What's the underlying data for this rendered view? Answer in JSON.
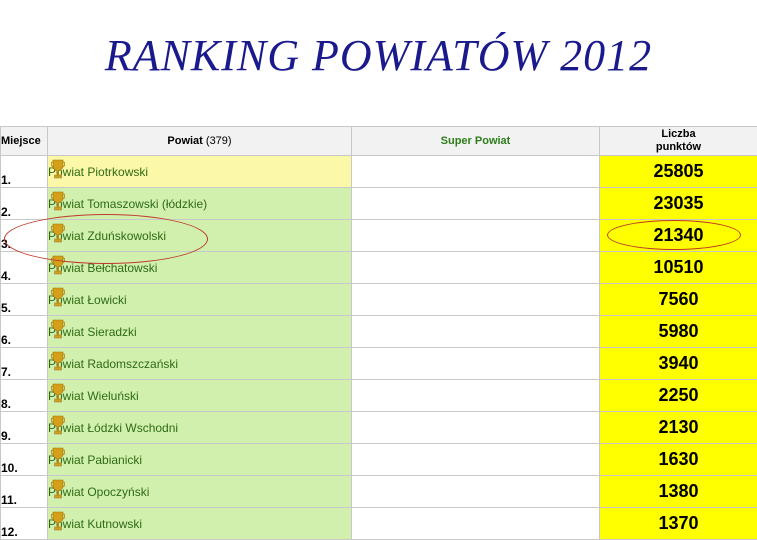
{
  "title": "RANKING POWIATÓW 2012",
  "headers": {
    "place": "Miejsce",
    "powiat": "Powiat",
    "powiat_count": "(379)",
    "super": "Super Powiat",
    "points_line1": "Liczba",
    "points_line2": "punktów"
  },
  "rows": [
    {
      "place": "1.",
      "name": "Powiat Piotrkowski",
      "points": "25805"
    },
    {
      "place": "2.",
      "name": "Powiat Tomaszowski (łódzkie)",
      "points": "23035"
    },
    {
      "place": "3.",
      "name": "Powiat Zduńskowolski",
      "points": "21340"
    },
    {
      "place": "4.",
      "name": "Powiat Bełchatowski",
      "points": "10510"
    },
    {
      "place": "5.",
      "name": "Powiat Łowicki",
      "points": "7560"
    },
    {
      "place": "6.",
      "name": "Powiat Sieradzki",
      "points": "5980"
    },
    {
      "place": "7.",
      "name": "Powiat Radomszczański",
      "points": "3940"
    },
    {
      "place": "8.",
      "name": "Powiat Wieluński",
      "points": "2250"
    },
    {
      "place": "9.",
      "name": "Powiat Łódzki Wschodni",
      "points": "2130"
    },
    {
      "place": "10.",
      "name": "Powiat Pabianicki",
      "points": "1630"
    },
    {
      "place": "11.",
      "name": "Powiat Opoczyński",
      "points": "1380"
    },
    {
      "place": "12.",
      "name": "Powiat Kutnowski",
      "points": "1370"
    }
  ],
  "colors": {
    "title": "#1a1a8c",
    "name_bg": "#d1f0ad",
    "name_bg_first": "#fbf8a8",
    "points_bg": "#ffff00",
    "highlight_ellipse": "#c0392b"
  },
  "icons": {
    "row_icon": "trophy-icon"
  }
}
